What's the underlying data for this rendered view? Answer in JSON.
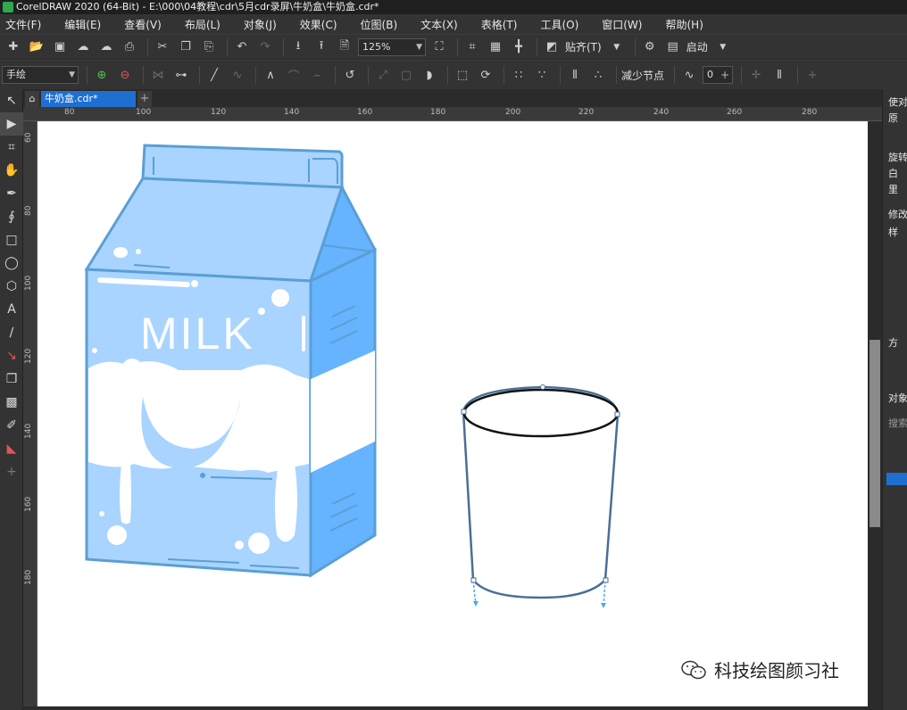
{
  "window": {
    "title": "CorelDRAW 2020 (64-Bit) - E:\\000\\04教程\\cdr\\5月cdr录屏\\牛奶盒\\牛奶盒.cdr*"
  },
  "menu": {
    "items": [
      "文件(F)",
      "编辑(E)",
      "查看(V)",
      "布局(L)",
      "对象(J)",
      "效果(C)",
      "位图(B)",
      "文本(X)",
      "表格(T)",
      "工具(O)",
      "窗口(W)",
      "帮助(H)"
    ]
  },
  "toolbar": {
    "zoom": "125%",
    "snap_label": "贴齐(T)",
    "launch_label": "启动",
    "freehand_mode": "手绘",
    "reduce_nodes_label": "减少节点",
    "smoothness_value": "0"
  },
  "tabs": {
    "document": "牛奶盒.cdr*"
  },
  "rulers": {
    "h_labels": [
      "80",
      "100",
      "120",
      "140",
      "160",
      "180",
      "200",
      "220",
      "240",
      "260",
      "280"
    ],
    "v_labels": [
      "60",
      "80",
      "100",
      "120",
      "140",
      "160",
      "180"
    ]
  },
  "artwork": {
    "carton_text": "MILK",
    "carton_blue": "#66b3ff",
    "carton_light": "#a8d4ff",
    "carton_outline": "#5a9fd4"
  },
  "right_panel": {
    "labels": [
      "使对",
      "原",
      "旋转",
      "白",
      "里",
      "修改",
      "样",
      "方",
      "对象",
      "搜索"
    ]
  },
  "watermark": {
    "text": "科技绘图颜习社"
  }
}
